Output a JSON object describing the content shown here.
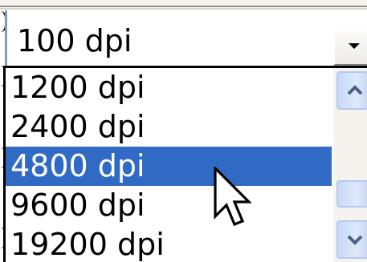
{
  "combo": {
    "selected_value": "100 dpi",
    "button_icon": "chevron-down-icon"
  },
  "dropdown": {
    "options": [
      {
        "label": "1200 dpi",
        "selected": false
      },
      {
        "label": "2400 dpi",
        "selected": false
      },
      {
        "label": "4800 dpi",
        "selected": true
      },
      {
        "label": "9600 dpi",
        "selected": false
      },
      {
        "label": "19200 dpi",
        "selected": false
      }
    ],
    "scroll_up_icon": "chevron-up-icon",
    "scroll_down_icon": "chevron-down-icon"
  },
  "colors": {
    "selection": "#316ac5",
    "selection_text": "#ffffff",
    "scrollbar_button": "#c7d8f8"
  },
  "cursor_icon": "mouse-pointer-icon"
}
